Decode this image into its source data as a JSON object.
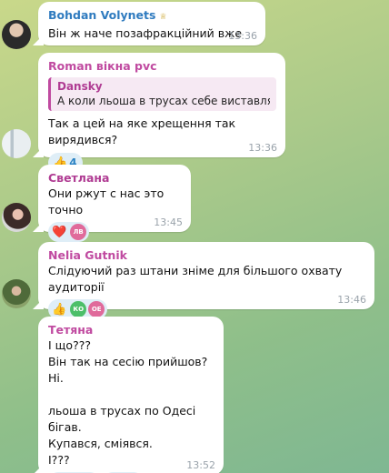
{
  "messages": [
    {
      "sender": "Bohdan Volynets",
      "sender_color": "#2f7bbf",
      "badge_icon": "medal",
      "text": "Він ж наче позафракційний вже",
      "time": "13:36"
    },
    {
      "sender": "Roman вікна pvc",
      "sender_color": "#c04aa0",
      "reply_name": "Dansky",
      "reply_text": "А коли льоша в трусах себе виставляв...",
      "text": "Так а цей на яке хрещення так вирядився?",
      "reaction_emoji": "👍",
      "reaction_count": "4",
      "time": "13:36"
    },
    {
      "sender": "Светлана",
      "sender_color": "#b03c93",
      "text": "Они ржут с нас это точно",
      "reaction_emoji": "❤️",
      "reactor_initials": "ЛВ",
      "time": "13:45"
    },
    {
      "sender": "Nelia Gutnik",
      "sender_color": "#c04aa0",
      "text": "Слідуючий раз штани зніме для більшого охвату аудиторії",
      "reaction_emoji": "👍",
      "reactor_initials_1": "КО",
      "reactor_initials_2": "ОЕ",
      "time": "13:46"
    },
    {
      "sender": "Тетяна",
      "sender_color": "#c04aa0",
      "text": "І що???\nВін так на сесію прийшов?\nНі.\n\nльоша в трусах по Одесі  бігав.\nКупався, сміявся.\nІ???",
      "reaction_emoji_1": "👍",
      "reaction_emoji_2": "👎",
      "reactor_initials": "ЛВ",
      "time": "13:52"
    }
  ]
}
